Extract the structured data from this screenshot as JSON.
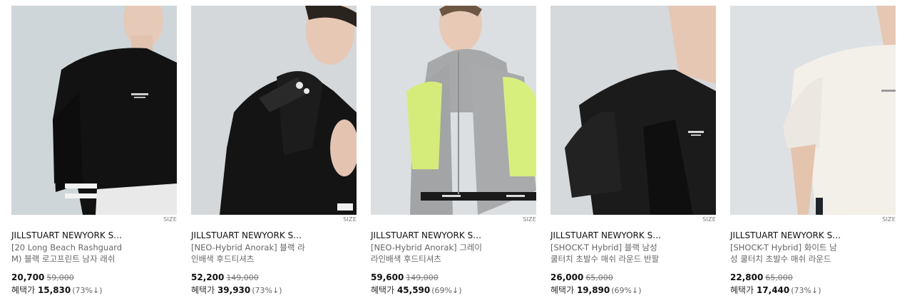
{
  "products": [
    {
      "size_label": "SIZE",
      "brand": "JILLSTUART NEWYORK S…",
      "name": "[20 Long Beach Rashguard\nM) 블랙 로고프린트 남자 래쉬",
      "price": "20,700",
      "original_price": "59,000",
      "benefit_label": "혜택가",
      "benefit_price": "15,830",
      "benefit_discount": "(73%↓)",
      "image": "black-long-sleeve-rashguard-photo"
    },
    {
      "size_label": "SIZE",
      "brand": "JILLSTUART NEWYORK S…",
      "name": "[NEO-Hybrid Anorak] 블랙 라\n인배색 후드티셔츠",
      "price": "52,200",
      "original_price": "149,000",
      "benefit_label": "혜택가",
      "benefit_price": "39,930",
      "benefit_discount": "(73%↓)",
      "image": "black-anorak-hoodie-photo"
    },
    {
      "size_label": "SIZE",
      "brand": "JILLSTUART NEWYORK S…",
      "name": "[NEO-Hybrid Anorak] 그레이\n라인배색 후드티셔츠",
      "price": "59,600",
      "original_price": "149,000",
      "benefit_label": "혜택가",
      "benefit_price": "45,590",
      "benefit_discount": "(69%↓)",
      "image": "grey-lime-anorak-hoodie-photo"
    },
    {
      "size_label": "SIZE",
      "brand": "JILLSTUART NEWYORK S…",
      "name": "[SHOCK-T Hybrid] 블랙 남성\n쿨터치 초발수 매쉬 라운드 반팔",
      "price": "26,000",
      "original_price": "65,000",
      "benefit_label": "혜택가",
      "benefit_price": "19,890",
      "benefit_discount": "(69%↓)",
      "image": "black-mesh-tshirt-photo"
    },
    {
      "size_label": "SIZE",
      "brand": "JILLSTUART NEWYORK S…",
      "name": "[SHOCK-T Hybrid] 화이트 남\n성 쿨터치 초발수 매쉬 라운드",
      "price": "22,800",
      "original_price": "65,000",
      "benefit_label": "혜택가",
      "benefit_price": "17,440",
      "benefit_discount": "(73%↓)",
      "image": "white-mesh-tshirt-photo"
    }
  ]
}
